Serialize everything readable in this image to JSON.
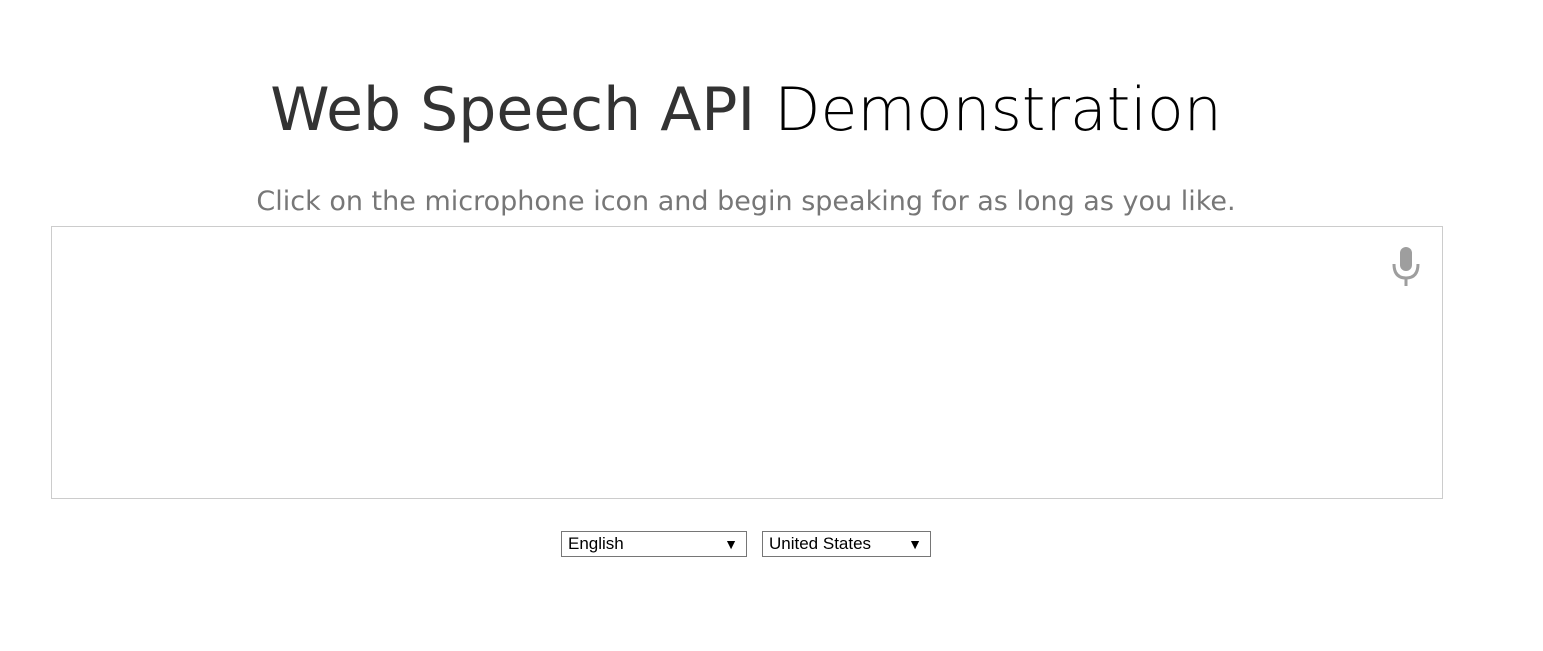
{
  "header": {
    "title_bold": "Web Speech API",
    "title_light": "Demonstration"
  },
  "info": {
    "start_text": "Click on the microphone icon and begin speaking for as long as you like."
  },
  "results": {
    "final_text": "",
    "interim_text": ""
  },
  "mic": {
    "icon": "microphone-icon",
    "color": "#9e9e9e"
  },
  "language_select": {
    "selected": "English"
  },
  "dialect_select": {
    "selected": "United States"
  }
}
